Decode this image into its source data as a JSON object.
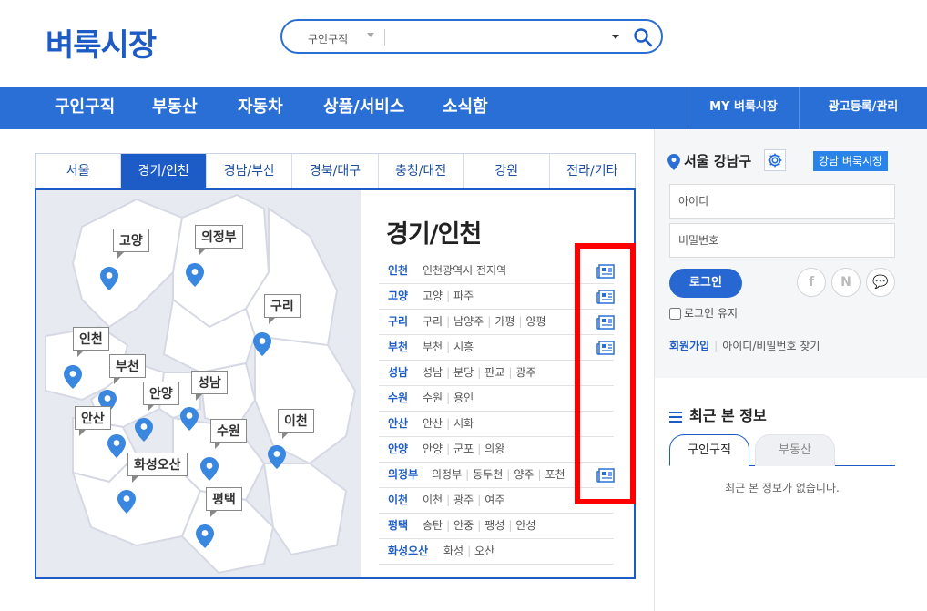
{
  "brand": {
    "logo": "벼룩시장"
  },
  "search": {
    "category": "구인구직",
    "placeholder": ""
  },
  "nav": {
    "items": [
      "구인구직",
      "부동산",
      "자동차",
      "상품/서비스",
      "소식함"
    ],
    "right": [
      "MY 벼룩시장",
      "광고등록/관리"
    ]
  },
  "region_tabs": [
    "서울",
    "경기/인천",
    "경남/부산",
    "경북/대구",
    "충청/대전",
    "강원",
    "전라/기타"
  ],
  "map_labels": [
    "고양",
    "의정부",
    "구리",
    "인천",
    "부천",
    "안양",
    "성남",
    "안산",
    "수원",
    "이천",
    "화성오산",
    "평택"
  ],
  "region": {
    "title": "경기/인천",
    "rows": [
      {
        "city": "인천",
        "subs": [
          "인천광역시 전지역"
        ],
        "paper": true
      },
      {
        "city": "고양",
        "subs": [
          "고양",
          "파주"
        ],
        "paper": true
      },
      {
        "city": "구리",
        "subs": [
          "구리",
          "남양주",
          "가평",
          "양평"
        ],
        "paper": true
      },
      {
        "city": "부천",
        "subs": [
          "부천",
          "시흥"
        ],
        "paper": true
      },
      {
        "city": "성남",
        "subs": [
          "성남",
          "분당",
          "판교",
          "광주"
        ],
        "paper": false
      },
      {
        "city": "수원",
        "subs": [
          "수원",
          "용인"
        ],
        "paper": false
      },
      {
        "city": "안산",
        "subs": [
          "안산",
          "시화"
        ],
        "paper": false
      },
      {
        "city": "안양",
        "subs": [
          "안양",
          "군포",
          "의왕"
        ],
        "paper": false
      },
      {
        "city": "의정부",
        "subs": [
          "의정부",
          "동두천",
          "양주",
          "포천"
        ],
        "paper": true
      },
      {
        "city": "이천",
        "subs": [
          "이천",
          "광주",
          "여주"
        ],
        "paper": false
      },
      {
        "city": "평택",
        "subs": [
          "송탄",
          "안중",
          "팽성",
          "안성"
        ],
        "paper": false
      },
      {
        "city": "화성오산",
        "subs": [
          "화성",
          "오산"
        ],
        "paper": false
      }
    ]
  },
  "sidebar": {
    "location": "서울 강남구",
    "local_button": "강남 벼룩시장",
    "id_placeholder": "아이디",
    "pw_placeholder": "비밀번호",
    "login_label": "로그인",
    "keep_label": "로그인 유지",
    "join_label": "회원가입",
    "find_label": "아이디/비밀번호 찾기",
    "sns": [
      "f",
      "N",
      "💬"
    ],
    "recent_title": "최근 본 정보",
    "recent_tabs": [
      "구인구직",
      "부동산"
    ],
    "recent_empty": "최근 본 정보가 없습니다."
  },
  "colors": {
    "brand": "#1d5cc7",
    "nav": "#2a6fd6",
    "highlight": "#ff0000",
    "pin": "#3a87e0"
  }
}
